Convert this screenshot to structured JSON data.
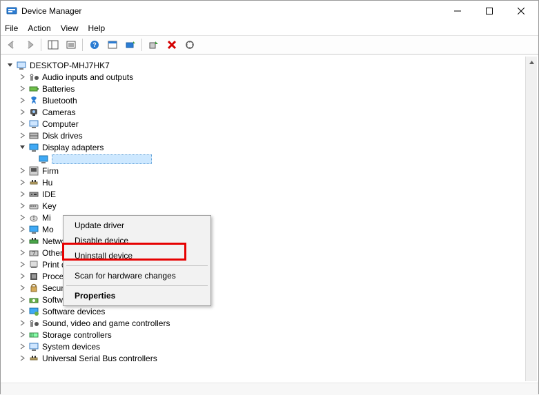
{
  "window": {
    "title": "Device Manager"
  },
  "menu": {
    "file": "File",
    "action": "Action",
    "view": "View",
    "help": "Help"
  },
  "tree": {
    "root": "DESKTOP-MHJ7HK7",
    "items": [
      {
        "label": "Audio inputs and outputs"
      },
      {
        "label": "Batteries"
      },
      {
        "label": "Bluetooth"
      },
      {
        "label": "Cameras"
      },
      {
        "label": "Computer"
      },
      {
        "label": "Disk drives"
      },
      {
        "label": "Display adapters"
      },
      {
        "label": "Firm"
      },
      {
        "label": "Hu"
      },
      {
        "label": "IDE"
      },
      {
        "label": "Key"
      },
      {
        "label": "Mi"
      },
      {
        "label": "Mo"
      },
      {
        "label": "Network adapters"
      },
      {
        "label": "Other devices"
      },
      {
        "label": "Print queues"
      },
      {
        "label": "Processors"
      },
      {
        "label": "Security devices"
      },
      {
        "label": "Software components"
      },
      {
        "label": "Software devices"
      },
      {
        "label": "Sound, video and game controllers"
      },
      {
        "label": "Storage controllers"
      },
      {
        "label": "System devices"
      },
      {
        "label": "Universal Serial Bus controllers"
      }
    ]
  },
  "ctx": {
    "update": "Update driver",
    "disable": "Disable device",
    "uninstall": "Uninstall device",
    "scan": "Scan for hardware changes",
    "properties": "Properties"
  }
}
